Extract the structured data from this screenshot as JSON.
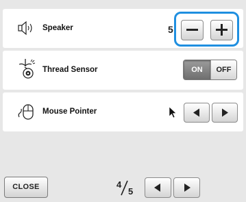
{
  "settings": {
    "speaker": {
      "label": "Speaker",
      "value_fragment": "5",
      "minus_icon": "minus-icon",
      "plus_icon": "plus-icon"
    },
    "thread_sensor": {
      "label": "Thread Sensor",
      "on_label": "ON",
      "off_label": "OFF",
      "selected": "ON"
    },
    "mouse_pointer": {
      "label": "Mouse Pointer",
      "left_icon": "arrow-left-icon",
      "right_icon": "arrow-right-icon"
    }
  },
  "footer": {
    "close_label": "CLOSE",
    "page_current": "4",
    "page_total": "5"
  },
  "colors": {
    "highlight": "#1f8fe0",
    "panel_bg": "#e7e7e7",
    "toggle_selected": "#7d7d7d"
  }
}
